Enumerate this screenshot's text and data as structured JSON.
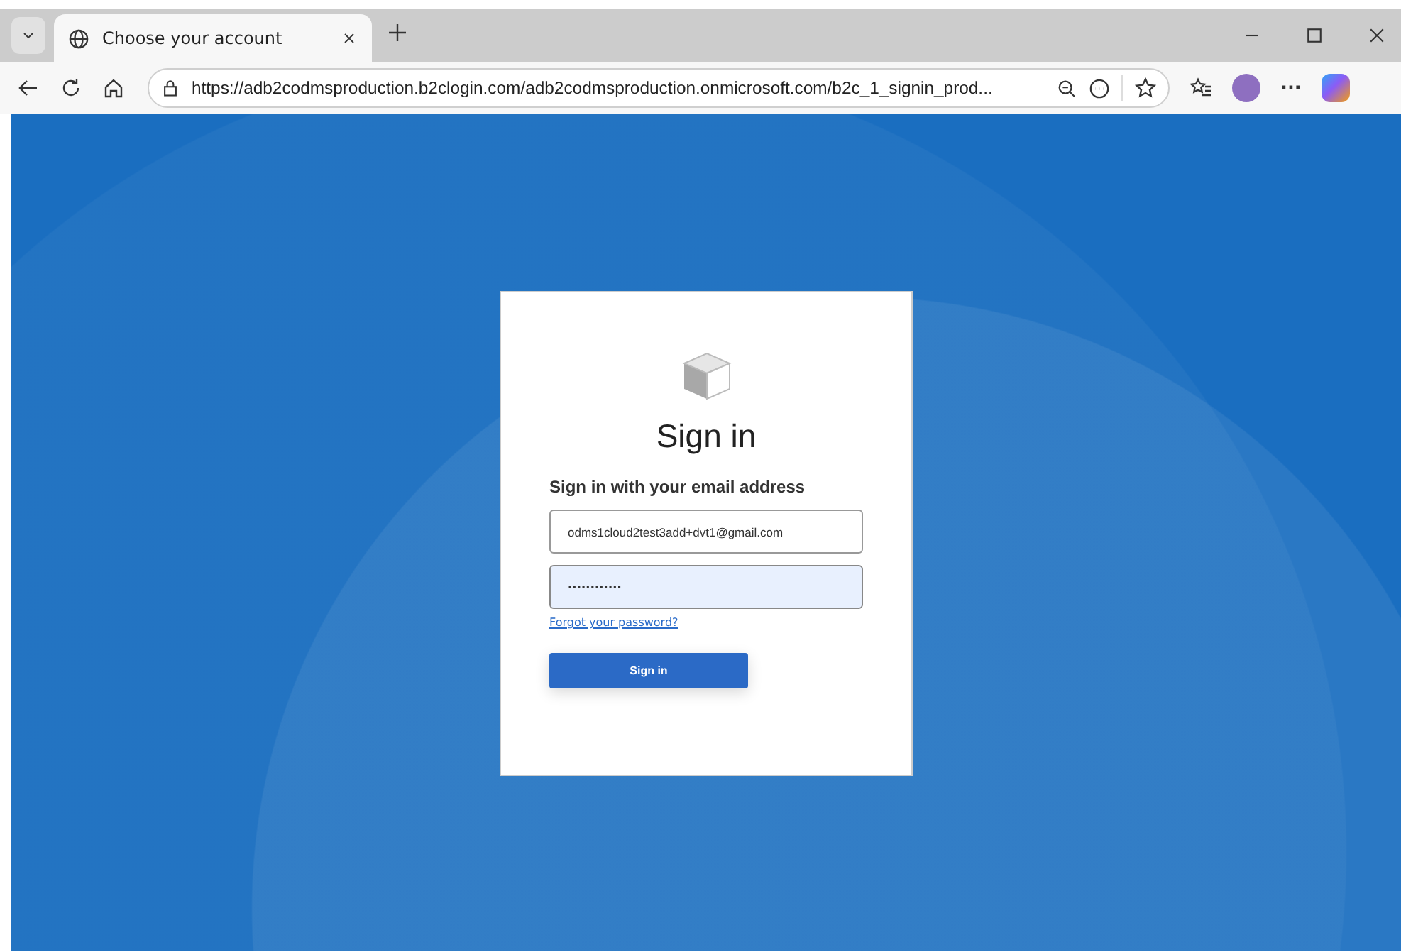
{
  "tabs": [
    {
      "title": "Choose your account",
      "selected": true
    }
  ],
  "address_bar": {
    "url": "https://adb2codmsproduction.b2clogin.com/adb2codmsproduction.onmicrosoft.com/b2c_1_signin_prod..."
  },
  "toolbar_buttons": [
    {
      "kind": "more",
      "label": "···"
    }
  ],
  "signin": {
    "title": "Sign in",
    "subtitle": "Sign in with your email address",
    "fields": [
      {
        "kind": "email",
        "value": "odms1cloud2test3add+dvt1@gmail.com",
        "focused": false
      },
      {
        "kind": "password",
        "value": "············",
        "focused": true
      }
    ],
    "forgot_link": "Forgot your password?",
    "button": "Sign in"
  }
}
